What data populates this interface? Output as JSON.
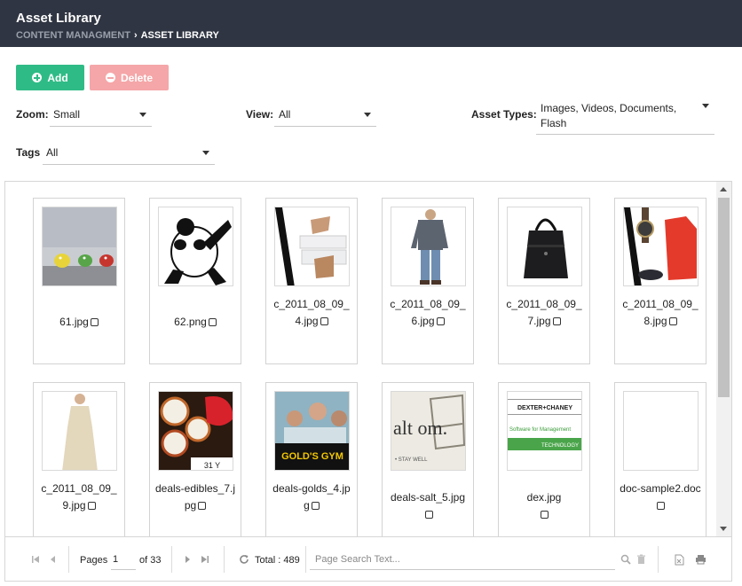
{
  "header": {
    "title": "Asset Library",
    "breadcrumb_parent": "CONTENT MANAGMENT",
    "breadcrumb_sep": "›",
    "breadcrumb_current": "ASSET LIBRARY"
  },
  "toolbar": {
    "add_label": "Add",
    "delete_label": "Delete"
  },
  "filters": {
    "zoom_label": "Zoom:",
    "zoom_value": "Small",
    "view_label": "View:",
    "view_value": "All",
    "types_label": "Asset Types:",
    "types_value": "Images, Videos, Documents, Flash",
    "tags_label": "Tags",
    "tags_value": "All"
  },
  "assets": [
    {
      "name": "61.jpg",
      "thumb": "birds"
    },
    {
      "name": "62.png",
      "thumb": "panda"
    },
    {
      "name": "c_2011_08_09_4.jpg",
      "thumb": "shoes"
    },
    {
      "name": "c_2011_08_09_6.jpg",
      "thumb": "man"
    },
    {
      "name": "c_2011_08_09_7.jpg",
      "thumb": "bag"
    },
    {
      "name": "c_2011_08_09_8.jpg",
      "thumb": "watch"
    },
    {
      "name": "c_2011_08_09_9.jpg",
      "thumb": "dress"
    },
    {
      "name": "deals-edibles_7.jpg",
      "thumb": "sushi"
    },
    {
      "name": "deals-golds_4.jpg",
      "thumb": "gym"
    },
    {
      "name": "deals-salt_5.jpg",
      "thumb": "salt"
    },
    {
      "name": "dex.jpg",
      "thumb": "dex"
    },
    {
      "name": "doc-sample2.doc",
      "thumb": "blank"
    }
  ],
  "thumb_text": {
    "gym": "GOLD'S GYM",
    "salt": "alt om.",
    "salt_sub": "• STAY WELL",
    "dex_logo": "DEXTER+CHANEY",
    "dex_line": "Software for Management",
    "dex_tech": "TECHNOLOGY",
    "sushi": "31 Y"
  },
  "pager": {
    "pages_label": "Pages",
    "current_page": "1",
    "of_label": "of 33",
    "total_label": "Total : 489",
    "search_placeholder": "Page Search Text..."
  },
  "colors": {
    "header_bg": "#2f3542",
    "add_green": "#2fbb86",
    "delete_pink": "#f5a6a8"
  }
}
